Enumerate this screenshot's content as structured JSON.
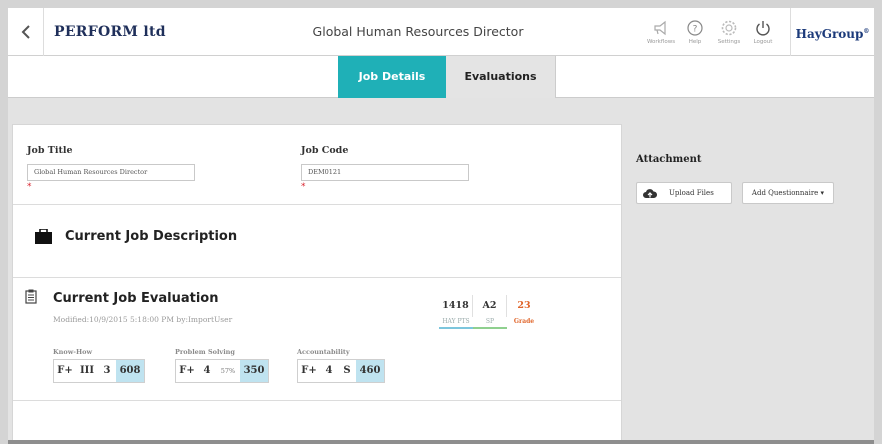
{
  "header": {
    "brand": "PERFORM ltd",
    "title": "Global Human Resources Director",
    "tools": [
      {
        "label": "Workflows",
        "icon": "workflows-icon"
      },
      {
        "label": "Help",
        "icon": "help-icon"
      },
      {
        "label": "Settings",
        "icon": "settings-icon"
      },
      {
        "label": "Logout",
        "icon": "power-icon"
      }
    ],
    "logo": "HayGroup",
    "logo_mark": "®"
  },
  "tabs": [
    {
      "label": "Job Details",
      "active": true
    },
    {
      "label": "Evaluations",
      "active": false
    }
  ],
  "job": {
    "title_label": "Job Title",
    "title_value": "Global Human Resources Director",
    "code_label": "Job Code",
    "code_value": "DEM0121",
    "required_mark": "*"
  },
  "description": {
    "title": "Current Job Description"
  },
  "evaluation": {
    "title": "Current Job Evaluation",
    "modified": "Modified:10/9/2015 5:18:00 PM by:ImportUser",
    "summary": [
      {
        "value": "1418",
        "label": "HAY PTS",
        "color": "#333333",
        "underline": "#7cc6dd"
      },
      {
        "value": "A2",
        "label": "SP",
        "color": "#333333",
        "underline": "#8fd08f"
      },
      {
        "value": "23",
        "label": "Grade",
        "color": "#e0652a",
        "underline": "#ffffff"
      }
    ],
    "groups": [
      {
        "label": "Know-How",
        "cells": [
          "F+",
          "III",
          "3"
        ],
        "points": "608"
      },
      {
        "label": "Problem Solving",
        "cells": [
          "F+",
          "4"
        ],
        "percent": "57%",
        "points": "350"
      },
      {
        "label": "Accountability",
        "cells": [
          "F+",
          "4",
          "S"
        ],
        "points": "460"
      }
    ]
  },
  "attachment": {
    "title": "Attachment",
    "upload_label": "Upload Files",
    "questionnaire_label": "Add Questionnaire ▾"
  },
  "colors": {
    "accent": "#1fb0b7",
    "highlight": "#bfe3f0",
    "required": "#d9242f",
    "grade": "#e0652a"
  }
}
